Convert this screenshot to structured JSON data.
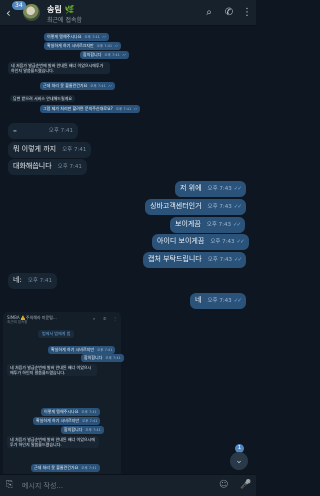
{
  "header": {
    "unread_count": "34",
    "name": "송림 🌿",
    "status": "최근에 접속함",
    "back_icon": "back-arrow-icon",
    "search_icon": "search-icon",
    "call_icon": "phone-icon",
    "menu_icon": "more-vertical-icon"
  },
  "embedded_top": [
    {
      "text": "이렇게 맹해주시나요",
      "time": "오후 7:41",
      "side": "out"
    },
    {
      "text": "확실하게 하기 시비르끄지만",
      "time": "오후 7:41",
      "side": "out"
    },
    {
      "text": "합의합니다",
      "time": "오후 7:41",
      "side": "out"
    },
    {
      "text": "네 처음가 발급순번에 발바 안내된 배너 이었으시에투가 하인지 말씀을드렸습니다.",
      "time": "",
      "side": "in"
    },
    {
      "text": "근데 처리 못 볼줄란건가요",
      "time": "오후 7:41",
      "side": "out"
    },
    {
      "text": "답변 받으려 서비스 안내해드릴게요",
      "time": "",
      "side": "in"
    },
    {
      "text": "그럼 제가 처리만 할려면 문의주신대로요?",
      "time": "오후 7:41",
      "side": "out"
    }
  ],
  "big_messages": [
    {
      "text": "오후 7:41",
      "time": "",
      "side": "in",
      "checks": ""
    },
    {
      "text": "뭐 이렇게 까지",
      "time": "오후 7:41",
      "side": "in",
      "checks": ""
    },
    {
      "text": "대화해씁니다",
      "time": "오후 7:41",
      "side": "in",
      "checks": ""
    },
    {
      "text": "저 위에",
      "time": "오후 7:43",
      "side": "out",
      "checks": "✓✓"
    },
    {
      "text": "싱바고객센터인거",
      "time": "오후 7:43",
      "side": "out",
      "checks": "✓✓"
    },
    {
      "text": "보이게끔",
      "time": "오후 7:43",
      "side": "out",
      "checks": "✓✓"
    },
    {
      "text": "아이디 보이게끔",
      "time": "오후 7:43",
      "side": "out",
      "checks": "✓✓"
    },
    {
      "text": "캡처 부탁드립니다",
      "time": "오후 7:43",
      "side": "out",
      "checks": "✓✓"
    },
    {
      "text": "네:",
      "time": "오후 7:41",
      "side": "in",
      "checks": ""
    },
    {
      "text": "네",
      "time": "오후 7:43",
      "side": "out",
      "checks": "✓✓"
    }
  ],
  "forwarded": {
    "head": "SIMBA ⚠️주의해라 미운털...",
    "sub": "최근에 접속함",
    "pill": "법에서 법에게 법",
    "icons": [
      "search-icon",
      "phone-icon",
      "more-vertical-icon"
    ],
    "messages": [
      {
        "text": "확실하게 하기 시비르지만",
        "time": "오후 7:41",
        "side": "out"
      },
      {
        "text": "합의합니다",
        "time": "오후 7:41",
        "side": "out"
      },
      {
        "text": "네 처음가 발급순번에 발바 안내된 배너 이었으시에투가 하인지 말씀을드렸습니다.",
        "time": "",
        "side": "in"
      },
      {
        "text": "이렇게 맹해주시나요",
        "time": "오후 7:41",
        "side": "out"
      },
      {
        "text": "확실하게 하기 시비르지만",
        "time": "오후 7:41",
        "side": "out"
      },
      {
        "text": "합의합니다",
        "time": "오후 7:41",
        "side": "out"
      },
      {
        "text": "네 처음가 발급순번에 발바 안내된 배너 이었으시에투가 하인지 말씀을드렸습니다.",
        "time": "",
        "side": "in"
      },
      {
        "text": "근데 처리 못 볼줄란건가요",
        "time": "오후 7:41",
        "side": "out"
      }
    ]
  },
  "composer": {
    "placeholder": "메시지 작성...",
    "attach_icon": "paperclip-icon",
    "sticker_icon": "sticker-icon",
    "mic_icon": "microphone-icon"
  },
  "scroll": {
    "badge": "1",
    "icon": "chevron-down-icon"
  }
}
